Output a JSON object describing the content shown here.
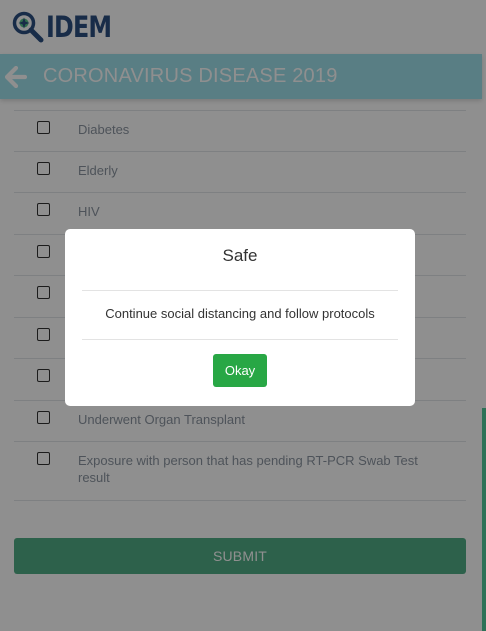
{
  "header": {
    "logo_text": "IDEM",
    "logo_icon": "magnifier-icon"
  },
  "titlebar": {
    "back_icon": "arrow-left-icon",
    "title": "CORONAVIRUS DISEASE 2019"
  },
  "checklist": {
    "items": [
      {
        "label": "Diabetes",
        "checked": false
      },
      {
        "label": "Elderly",
        "checked": false
      },
      {
        "label": "HIV",
        "checked": false
      },
      {
        "label": "",
        "checked": false
      },
      {
        "label": "",
        "checked": false
      },
      {
        "label": "",
        "checked": false
      },
      {
        "label": "",
        "checked": false
      },
      {
        "label": "Underwent Organ Transplant",
        "checked": false
      },
      {
        "label": "Exposure with person that has pending RT-PCR Swab Test result",
        "checked": false
      }
    ]
  },
  "submit_label": "SUBMIT",
  "modal": {
    "title": "Safe",
    "message": "Continue social distancing and follow protocols",
    "ok_label": "Okay"
  },
  "colors": {
    "titlebar": "#9fe0ec",
    "submit": "#51ae87",
    "ok_button": "#28a745",
    "logo": "#2c4f80"
  }
}
